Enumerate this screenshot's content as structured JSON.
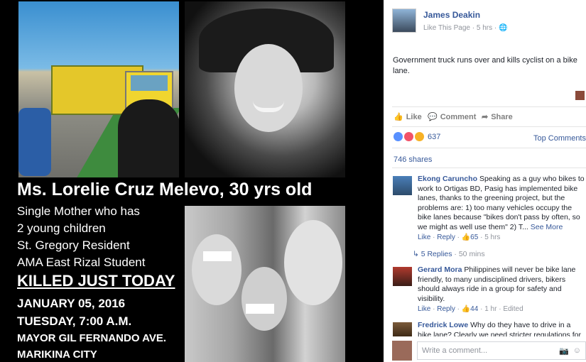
{
  "poster": {
    "name_line": "Ms. Lorelie Cruz Melevo, 30 yrs old",
    "details": [
      "Single Mother who has",
      "2 young children",
      "St. Gregory Resident",
      "AMA East Rizal Student"
    ],
    "headline": "KILLED JUST TODAY",
    "date": "JANUARY 05, 2016",
    "time": "TUESDAY, 7:00 A.M.",
    "place1": "MAYOR GIL FERNANDO AVE.",
    "place2": "MARIKINA CITY"
  },
  "post": {
    "page_name": "James Deakin",
    "like_page": "Like This Page",
    "time": "5 hrs",
    "text": "Government truck runs over and kills cyclist on a bike lane."
  },
  "actions": {
    "like": "Like",
    "comment": "Comment",
    "share": "Share"
  },
  "reactions": {
    "count": "637",
    "top_comments": "Top Comments"
  },
  "shares": "746 shares",
  "comments": [
    {
      "name": "Ekong Caruncho",
      "text": "Speaking as a guy who bikes to work to Ortigas BD, Pasig has implemented bike lanes, thanks to the greening project, but the problems are: 1) too many vehicles occupy the bike lanes because \"bikes don't pass by often, so we might as well use them\" 2) T...",
      "see_more": "See More",
      "like": "Like",
      "reply": "Reply",
      "likes": "65",
      "time": "5 hrs"
    },
    {
      "name": "Gerard Mora",
      "text": "Philippines will never be bike lane friendly, to many undisciplined drivers, bikers should always ride in a group for safety and visibility.",
      "like": "Like",
      "reply": "Reply",
      "likes": "44",
      "time": "1 hr",
      "edited": "Edited"
    },
    {
      "name": "Fredrick Lowe",
      "text": "Why do they have to drive in a bike lane? Clearly we need stricter regulations for"
    }
  ],
  "replies": {
    "label": "5 Replies",
    "time": "50 mins"
  },
  "composer": {
    "placeholder": "Write a comment..."
  },
  "colors": {
    "link": "#365899",
    "muted": "#90949c"
  },
  "icons": [
    "globe-icon",
    "thumbs-up-icon",
    "comment-icon",
    "share-icon",
    "camera-icon",
    "sticker-icon",
    "reply-arrow-icon"
  ]
}
